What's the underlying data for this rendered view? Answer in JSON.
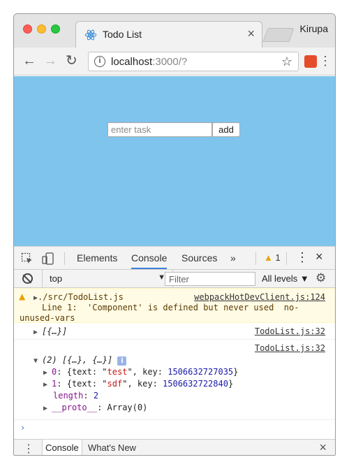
{
  "browser": {
    "tab_title": "Todo List",
    "tab_icon": "react-logo-icon",
    "profile_name": "Kirupa",
    "url_host": "localhost",
    "url_rest": ":3000/?"
  },
  "page": {
    "background_color": "#7fc4ec",
    "task_placeholder": "enter task",
    "add_label": "add"
  },
  "devtools": {
    "tabs": [
      "Elements",
      "Console",
      "Sources"
    ],
    "active_tab": "Console",
    "more_tabs": "»",
    "warning_count": "1",
    "context": "top",
    "filter_placeholder": "Filter",
    "levels": "All levels"
  },
  "console": {
    "warning": {
      "path": "./src/TodoList.js",
      "source": "webpackHotDevClient.js:124",
      "line1": "Line 1:  'Component' is defined but never used  no-",
      "line2": "unused-vars"
    },
    "log1": {
      "text": "[{…}]",
      "source": "TodoList.js:32"
    },
    "log2": {
      "source": "TodoList.js:32",
      "summary": "(2) [{…}, {…}]",
      "items": [
        {
          "index": "0",
          "text": "test",
          "key": "1506632727035"
        },
        {
          "index": "1",
          "text": "sdf",
          "key": "1506632722840"
        }
      ],
      "length_label": "length",
      "length_value": "2",
      "proto_label": "__proto__",
      "proto_value": "Array(0)"
    }
  },
  "drawer": {
    "tabs": [
      "Console",
      "What's New"
    ]
  }
}
